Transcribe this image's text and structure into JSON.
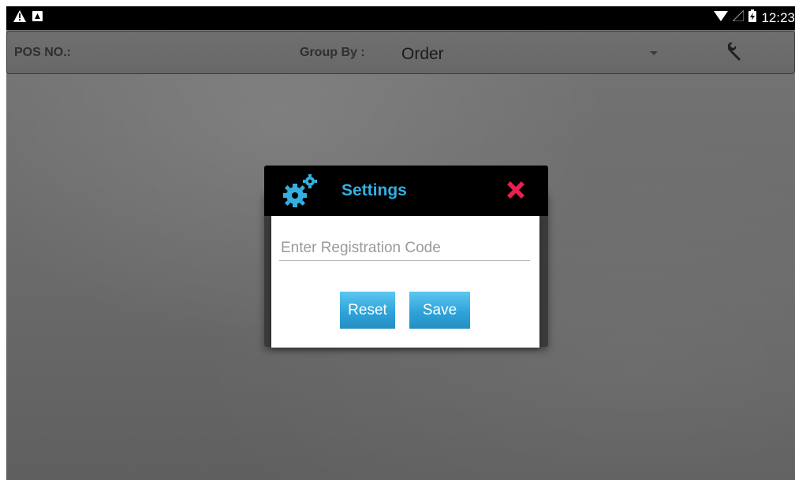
{
  "status_bar": {
    "time": "12:23",
    "icons": [
      "warning-icon",
      "notification-icon",
      "wifi-icon",
      "signal-icon",
      "battery-icon"
    ]
  },
  "toolbar": {
    "pos_label": "POS NO.:",
    "pos_value": "",
    "group_by_label": "Group By :",
    "group_by_value": "Order",
    "settings_icon": "wrench-icon"
  },
  "dialog": {
    "title": "Settings",
    "header_icon": "gears-icon",
    "close_icon": "close-icon",
    "registration_input": {
      "value": "",
      "placeholder": "Enter Registration Code"
    },
    "reset_label": "Reset",
    "save_label": "Save"
  },
  "colors": {
    "accent_blue": "#35aee0",
    "button_blue": "#2fa3d9",
    "close_red": "#e8204f",
    "background_gray": "#6e6e6e"
  }
}
